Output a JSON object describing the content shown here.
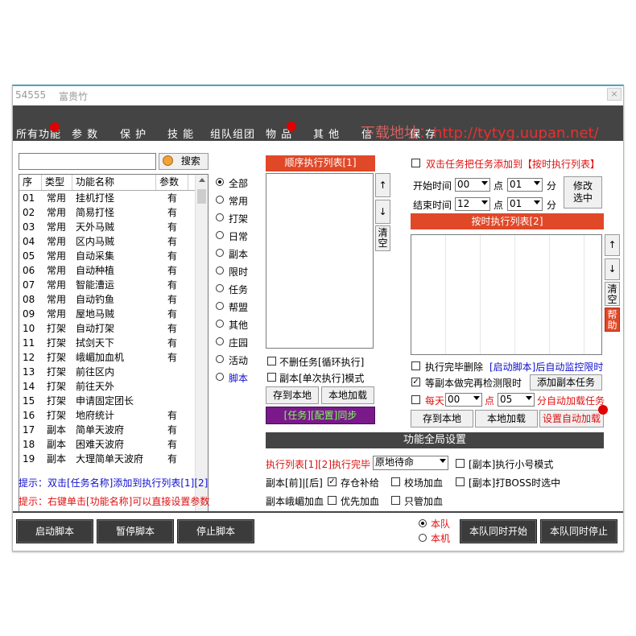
{
  "window": {
    "id_text": "54555",
    "character": "富贵竹",
    "close": "×"
  },
  "menu": [
    "所有功能",
    "参 数",
    "保 护",
    "技 能",
    "组队组团",
    "物 品",
    "其 他",
    "信",
    "保 存"
  ],
  "watermark": {
    "cn": "下载地址",
    "url": "：http://tytyg.uupan.net/"
  },
  "search": {
    "value": "",
    "button_label": "搜索"
  },
  "func_list": {
    "headers": [
      "序",
      "类型",
      "功能名称",
      "参数"
    ],
    "rows": [
      [
        "01",
        "常用",
        "挂机打怪",
        "有"
      ],
      [
        "02",
        "常用",
        "简易打怪",
        "有"
      ],
      [
        "03",
        "常用",
        "天外马贼",
        "有"
      ],
      [
        "04",
        "常用",
        "区内马贼",
        "有"
      ],
      [
        "05",
        "常用",
        "自动采集",
        "有"
      ],
      [
        "06",
        "常用",
        "自动种植",
        "有"
      ],
      [
        "07",
        "常用",
        "智能漕运",
        "有"
      ],
      [
        "08",
        "常用",
        "自动钓鱼",
        "有"
      ],
      [
        "09",
        "常用",
        "屋地马贼",
        "有"
      ],
      [
        "10",
        "打架",
        "自动打架",
        "有"
      ],
      [
        "11",
        "打架",
        "拭剑天下",
        "有"
      ],
      [
        "12",
        "打架",
        "峨嵋加血机",
        "有"
      ],
      [
        "13",
        "打架",
        "前往区内",
        ""
      ],
      [
        "14",
        "打架",
        "前往天外",
        ""
      ],
      [
        "15",
        "打架",
        "申请固定团长",
        ""
      ],
      [
        "16",
        "打架",
        "地府统计",
        "有"
      ],
      [
        "17",
        "副本",
        "简单天波府",
        "有"
      ],
      [
        "18",
        "副本",
        "困难天波府",
        "有"
      ],
      [
        "19",
        "副本",
        "大理简单天波府",
        "有"
      ]
    ]
  },
  "filters": [
    "全部",
    "常用",
    "打架",
    "日常",
    "副本",
    "限时",
    "任务",
    "帮盟",
    "其他",
    "庄园",
    "活动",
    "脚本"
  ],
  "seq_list": {
    "title": "顺序执行列表[1]",
    "up": "↑",
    "down": "↓",
    "clear": "清空",
    "opt_no_delete": "不删任务[循环执行]",
    "opt_single": "副本[单次执行]模式",
    "save_local": "存到本地",
    "load_local": "本地加载",
    "sync": "[任务][配置]同步"
  },
  "timed": {
    "dbl_click_hint": "双击任务把任务添加到【按时执行列表】",
    "start_label": "开始时间",
    "start_h": "00",
    "point": "点",
    "start_m": "01",
    "minute": "分",
    "end_label": "结束时间",
    "end_h": "12",
    "end_m": "01",
    "modify": "修改选中",
    "title": "按时执行列表[2]",
    "up": "↑",
    "down": "↓",
    "clear": "清空",
    "help": "帮助",
    "opt_done_delete": "执行完毕删除",
    "opt_done_delete_note": "[启动脚本]后自动监控限时",
    "opt_wait_dungeon": "等副本做完再检测限时",
    "add_dungeon": "添加副本任务",
    "daily": "每天",
    "daily_h": "00",
    "daily_m": "05",
    "daily_suffix": "分自动加载任务",
    "save_local": "存到本地",
    "load_local": "本地加载",
    "auto_load": "设置自动加载"
  },
  "global": {
    "title": "功能全局设置",
    "list_done_label": "执行列表[1][2]执行完毕",
    "list_done_value": "原地待命",
    "opt_small": "[副本]执行小号模式",
    "dungeon_front_back": "副本[前]|[后]",
    "opt_store": "存仓补给",
    "opt_school_heal": "校场加血",
    "opt_boss": "[副本]打BOSS时选中",
    "emei_heal": "副本峨嵋加血",
    "opt_priority_heal": "优先加血",
    "opt_only_heal": "只管加血"
  },
  "hints": {
    "h1": "提示：双击[任务名称]添加到执行列表[1][2]",
    "h2": "提示：右键单击[功能名称]可以直接设置参数"
  },
  "bottom": {
    "start": "启动脚本",
    "pause": "暂停脚本",
    "stop": "停止脚本",
    "team": "本队",
    "local": "本机",
    "team_start": "本队同时开始",
    "team_stop": "本队同时停止"
  },
  "colors": {
    "accent_red": "#e04828",
    "dark": "#444444",
    "hint_blue": "#1010cc",
    "hint_red": "#e01010",
    "sync_purple": "#7a1a8a"
  }
}
